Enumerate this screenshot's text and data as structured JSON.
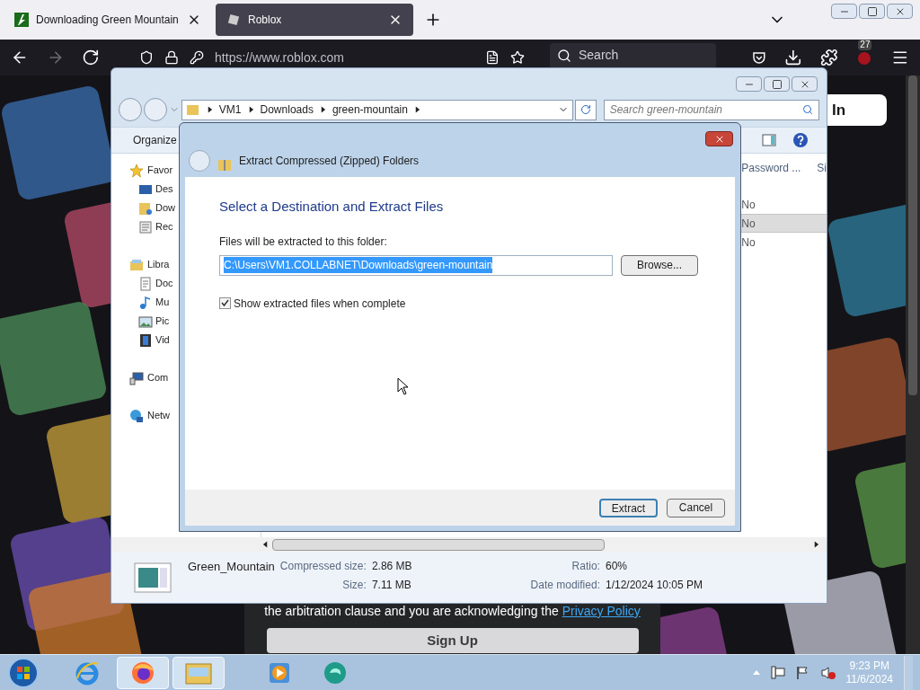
{
  "browser": {
    "tabs": [
      {
        "title": "Downloading Green Mountain",
        "selected": false
      },
      {
        "title": "Roblox",
        "selected": true
      }
    ],
    "url": "https://www.roblox.com",
    "search_placeholder": "Search",
    "badge": "27",
    "forward_disabled": true
  },
  "page": {
    "login_button": "In",
    "consent_text": "the arbitration clause and you are acknowledging the",
    "privacy_link": "Privacy Policy",
    "signup_button": "Sign Up"
  },
  "explorer": {
    "breadcrumb": [
      "VM1",
      "Downloads",
      "green-mountain"
    ],
    "search_placeholder": "Search green-mountain",
    "toolbar_button": "Organize",
    "nav": [
      {
        "label": "Favor",
        "kind": "star",
        "children": [
          {
            "label": "Des",
            "kind": "desktop"
          },
          {
            "label": "Dow",
            "kind": "downloads"
          },
          {
            "label": "Rec",
            "kind": "recent"
          }
        ]
      },
      {
        "label": "Libra",
        "kind": "library",
        "children": [
          {
            "label": "Doc",
            "kind": "document"
          },
          {
            "label": "Mu",
            "kind": "music"
          },
          {
            "label": "Pic",
            "kind": "pictures"
          },
          {
            "label": "Vid",
            "kind": "video"
          }
        ]
      },
      {
        "label": "Com",
        "kind": "computer"
      },
      {
        "label": "Netw",
        "kind": "network"
      }
    ],
    "columns": [
      "Password ...",
      "Si"
    ],
    "rows": [
      {
        "password": "No",
        "selected": false
      },
      {
        "password": "No",
        "selected": true
      },
      {
        "password": "No",
        "selected": false
      }
    ],
    "details": {
      "name": "Green_Mountain",
      "fields": [
        {
          "label": "Compressed size:",
          "value": "2.86 MB"
        },
        {
          "label": "Size:",
          "value": "7.11 MB"
        },
        {
          "label": "Ratio:",
          "value": "60%"
        },
        {
          "label": "Date modified:",
          "value": "1/12/2024 10:05 PM"
        }
      ]
    }
  },
  "dialog": {
    "title": "Extract Compressed (Zipped) Folders",
    "heading": "Select a Destination and Extract Files",
    "field_label": "Files will be extracted to this folder:",
    "path": "C:\\Users\\VM1.COLLABNET\\Downloads\\green-mountain",
    "browse_button": "Browse...",
    "show_files": {
      "label": "Show extracted files when complete",
      "checked": true
    },
    "buttons": [
      {
        "label": "Extract",
        "selected": true
      },
      {
        "label": "Cancel",
        "selected": false
      }
    ]
  },
  "taskbar": {
    "apps": [
      {
        "kind": "ie",
        "selected": false
      },
      {
        "kind": "firefox",
        "selected": true
      },
      {
        "kind": "explorer",
        "selected": true
      },
      {
        "kind": "media",
        "selected": false
      },
      {
        "kind": "app",
        "selected": false
      }
    ],
    "time": "9:23 PM",
    "date": "11/6/2024"
  }
}
